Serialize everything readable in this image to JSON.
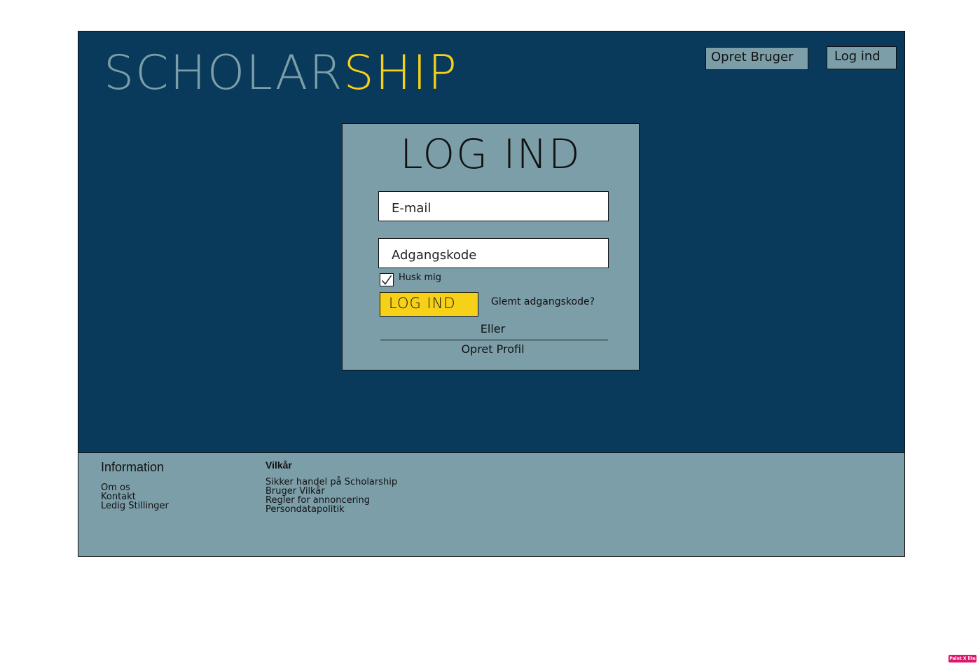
{
  "header": {
    "logo_part1": "SCHOLAR",
    "logo_part2": "SHIP",
    "register_button": "Opret Bruger",
    "login_button": "Log ind"
  },
  "login_form": {
    "title": "LOG IND",
    "email_placeholder": "E-mail",
    "password_placeholder": "Adgangskode",
    "remember_label": "Husk mig",
    "remember_checked": true,
    "submit_label": "LOG IND",
    "forgot_link": "Glemt adgangskode?",
    "or_text": "Eller",
    "create_profile_link": "Opret Profil"
  },
  "footer": {
    "info": {
      "heading": "Information",
      "links": [
        "Om os",
        "Kontakt",
        "Ledig Stillinger"
      ]
    },
    "terms": {
      "heading": "Vilkår",
      "links": [
        "Sikker handel på Scholarship",
        "Bruger Vilkår",
        "Regler for annoncering",
        "Persondatapolitik"
      ]
    }
  },
  "badge": {
    "label": "Paint X lite"
  },
  "colors": {
    "hero_bg": "#093a5c",
    "panel_bg": "#7c9ea8",
    "accent": "#f7d117"
  },
  "icons": {
    "checkbox_mark": "checkmark-icon"
  }
}
